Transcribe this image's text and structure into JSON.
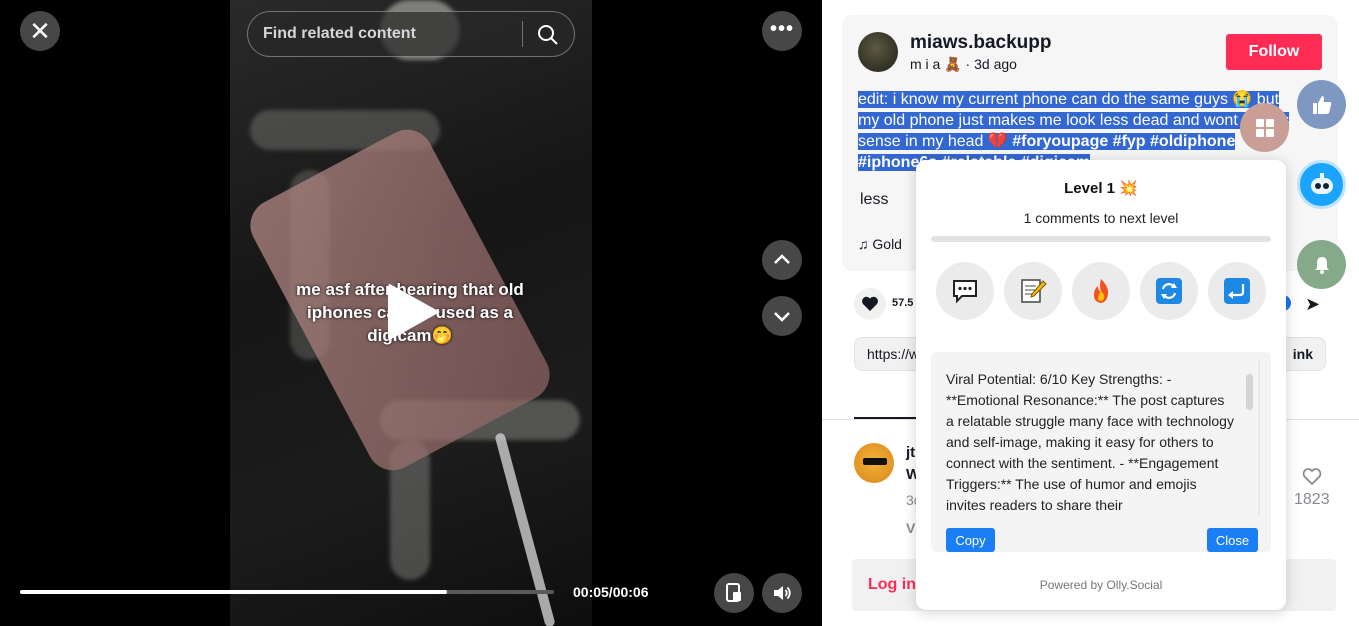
{
  "video": {
    "search_placeholder": "Find related content",
    "overlay_caption": "me asf after hearing that old iphones can be used as a digicam🤭",
    "time_readout": "00:05/00:06",
    "progress_fraction": 0.8,
    "icons": {
      "close": "close-icon",
      "search": "search-icon",
      "more": "more-icon",
      "play": "play-icon",
      "up": "chevron-up-icon",
      "down": "chevron-down-icon",
      "pip": "picture-in-picture-icon",
      "volume": "volume-icon"
    }
  },
  "post": {
    "username": "miaws.backupp",
    "subline": "m i a 🧸 · 3d ago",
    "follow_label": "Follow",
    "caption_plain": "edit: i know my current phone can do the same guys 😭 but my old phone just makes me look less dead and wont makes sense in my head 💔 ",
    "caption_tags": "#foryoupage #fyp #oldiphone #iphone6s #relatable #digicam",
    "less_label": "less",
    "music_label": "♫  Gold",
    "like_count": "57.5",
    "link_text": "https://w",
    "link_copy_label": "ink"
  },
  "comment": {
    "user": "jt",
    "text": "W",
    "meta": "3d",
    "view_label": "V",
    "like_count": "1823"
  },
  "login": {
    "label": "Log in"
  },
  "popup": {
    "level": "Level 1 💥",
    "next_level": "1 comments to next level",
    "progress_fraction": 0.0,
    "tools": [
      "comment-icon",
      "memo-icon",
      "fire-icon",
      "refresh-icon",
      "reply-icon"
    ],
    "analysis": "Viral Potential: 6/10 Key Strengths: - **Emotional Resonance:** The post captures a relatable struggle many face with technology and self-image, making it easy for others to connect with the sentiment. - **Engagement Triggers:** The use of humor and emojis invites readers to share their",
    "copy_label": "Copy",
    "close_label": "Close",
    "powered_by": "Powered by Olly.Social"
  },
  "colors": {
    "accent_red": "#fe2c55",
    "highlight_blue": "#3367d1",
    "button_blue": "#1a7ff5"
  }
}
